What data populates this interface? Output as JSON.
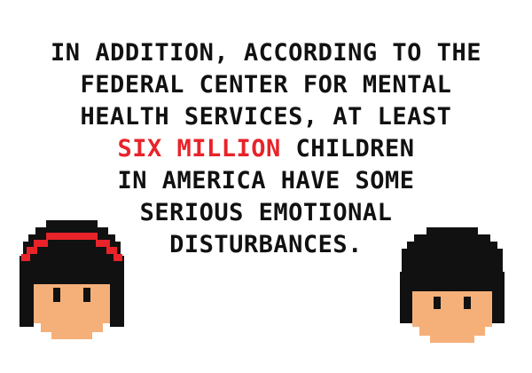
{
  "caption": {
    "line1": "IN ADDITION, ACCORDING TO THE",
    "line2": "FEDERAL CENTER FOR MENTAL",
    "line3": "HEALTH SERVICES, AT LEAST",
    "line4_highlight": "SIX MILLION",
    "line4_rest": " CHILDREN",
    "line5": "IN AMERICA HAVE SOME",
    "line6": "SERIOUS EMOTIONAL",
    "line7": "DISTURBANCES."
  },
  "colors": {
    "text": "#111111",
    "highlight": "#e8232a",
    "hair": "#111111",
    "headband": "#e8232a",
    "skin": "#f5b07a",
    "eyes": "#111111"
  },
  "characters": {
    "left": "pixel-girl-with-red-headband",
    "right": "pixel-boy"
  }
}
